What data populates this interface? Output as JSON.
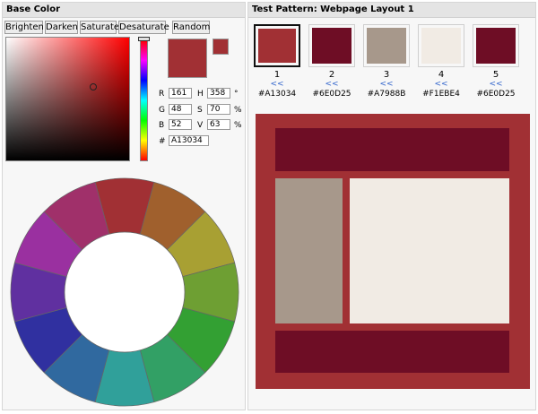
{
  "left_panel": {
    "title": "Base Color",
    "buttons": {
      "brighten": "Brighten",
      "darken": "Darken",
      "saturate": "Saturate",
      "desaturate": "Desaturate",
      "random": "Random"
    },
    "fields": {
      "r_label": "R",
      "r_value": "161",
      "g_label": "G",
      "g_value": "48",
      "b_label": "B",
      "b_value": "52",
      "h_label": "H",
      "h_value": "358",
      "h_unit": "°",
      "s_label": "S",
      "s_value": "70",
      "s_unit": "%",
      "v_label": "V",
      "v_value": "63",
      "v_unit": "%",
      "hex_label": "#",
      "hex_value": "A13034"
    },
    "current_color": "#A13034",
    "previous_color": "#A13034",
    "picker_hue_color": "#ff0000",
    "wheel_colors": [
      "#A13034",
      "#A0602D",
      "#A8A033",
      "#6E9F33",
      "#33A033",
      "#32A065",
      "#30A09A",
      "#30699F",
      "#3030A0",
      "#6030A0",
      "#9A30A0",
      "#A0306A"
    ]
  },
  "right_panel": {
    "title": "Test Pattern: Webpage Layout 1",
    "link_text": "<<",
    "swatches": [
      {
        "num": "1",
        "hex": "#A13034",
        "color": "#A13034"
      },
      {
        "num": "2",
        "hex": "#6E0D25",
        "color": "#6E0D25"
      },
      {
        "num": "3",
        "hex": "#A7988B",
        "color": "#A7988B"
      },
      {
        "num": "4",
        "hex": "#F1EBE4",
        "color": "#F1EBE4"
      },
      {
        "num": "5",
        "hex": "#6E0D25",
        "color": "#6E0D25"
      }
    ],
    "layout_colors": {
      "background": "#A13034",
      "header": "#6E0D25",
      "sidebar": "#A7988B",
      "content": "#F1EBE4",
      "footer": "#6E0D25"
    }
  }
}
